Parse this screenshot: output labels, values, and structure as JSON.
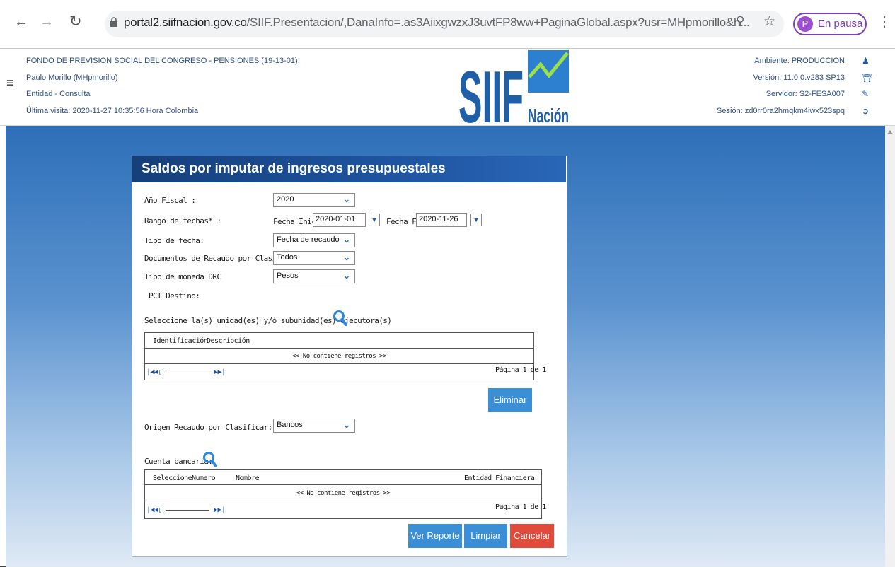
{
  "browser": {
    "url_host": "portal2.siifnacion.gov.co",
    "url_path": "/SIIF.Presentacion/,DanaInfo=.as3AiixgwzxJ3uvtFP8ww+PaginaGlobal.aspx?usr=MHpmorillo&h...",
    "profile_initial": "P",
    "profile_label": "En pausa"
  },
  "header": {
    "entity": "FONDO DE PREVISION SOCIAL DEL CONGRESO - PENSIONES (19-13-01)",
    "user": "Paulo Morillo (MHpmorillo)",
    "role": "Entidad - Consulta",
    "last_visit": "Última visita: 2020-11-27 10:35:56 Hora Colombia",
    "logo_text": "SIIF",
    "logo_sub": "Nación",
    "environment": "Ambiente: PRODUCCION",
    "version": "Versión: 11.0.0.v283 SP13",
    "server": "Servidor: S2-FESA007",
    "session": "Sesión: zd0rr0ra2hmqkm4iwx523spq"
  },
  "form": {
    "title": "Saldos por imputar de ingresos presupuestales",
    "fiscal_year_label": "Año Fiscal :",
    "fiscal_year_value": "2020",
    "date_range_label": "Rango de fechas* :",
    "start_label": "Fecha Inicio",
    "start_value": "2020-01-01",
    "end_label": "Fecha Fin",
    "end_value": "2020-11-26",
    "date_type_label": "Tipo de fecha:",
    "date_type_value": "Fecha de recaudo",
    "docs_label": "Documentos de Recaudo por Clasificar:",
    "docs_value": "Todos",
    "currency_label": "Tipo de moneda DRC",
    "currency_value": "Pesos",
    "pci_label": "PCI Destino:",
    "units_label": "Seleccione la(s) unidad(es) y/ó subunidad(es) ejecutora(s)",
    "units_grid": {
      "col_id": "Identificación",
      "col_desc": "Descripción",
      "empty": "<< No contiene registros >>",
      "page": "Página 1 de 1"
    },
    "delete_button": "Eliminar",
    "origin_label": "Origen Recaudo por Clasificar:",
    "origin_value": "Bancos",
    "account_label": "Cuenta bancaria:",
    "account_grid": {
      "col_select": "Seleccione",
      "col_number": "Numero",
      "col_name": "Nombre",
      "col_bank": "Entidad Financiera",
      "empty": "<< No contiene registros >>",
      "page": "Pagina 1 de 1"
    },
    "report_button": "Ver Reporte",
    "clear_button": "Limpiar",
    "cancel_button": "Cancelar"
  },
  "colors": {
    "title_bar": "#1e54a0",
    "button_blue": "#3a8fd6",
    "button_red": "#e04b3c"
  }
}
